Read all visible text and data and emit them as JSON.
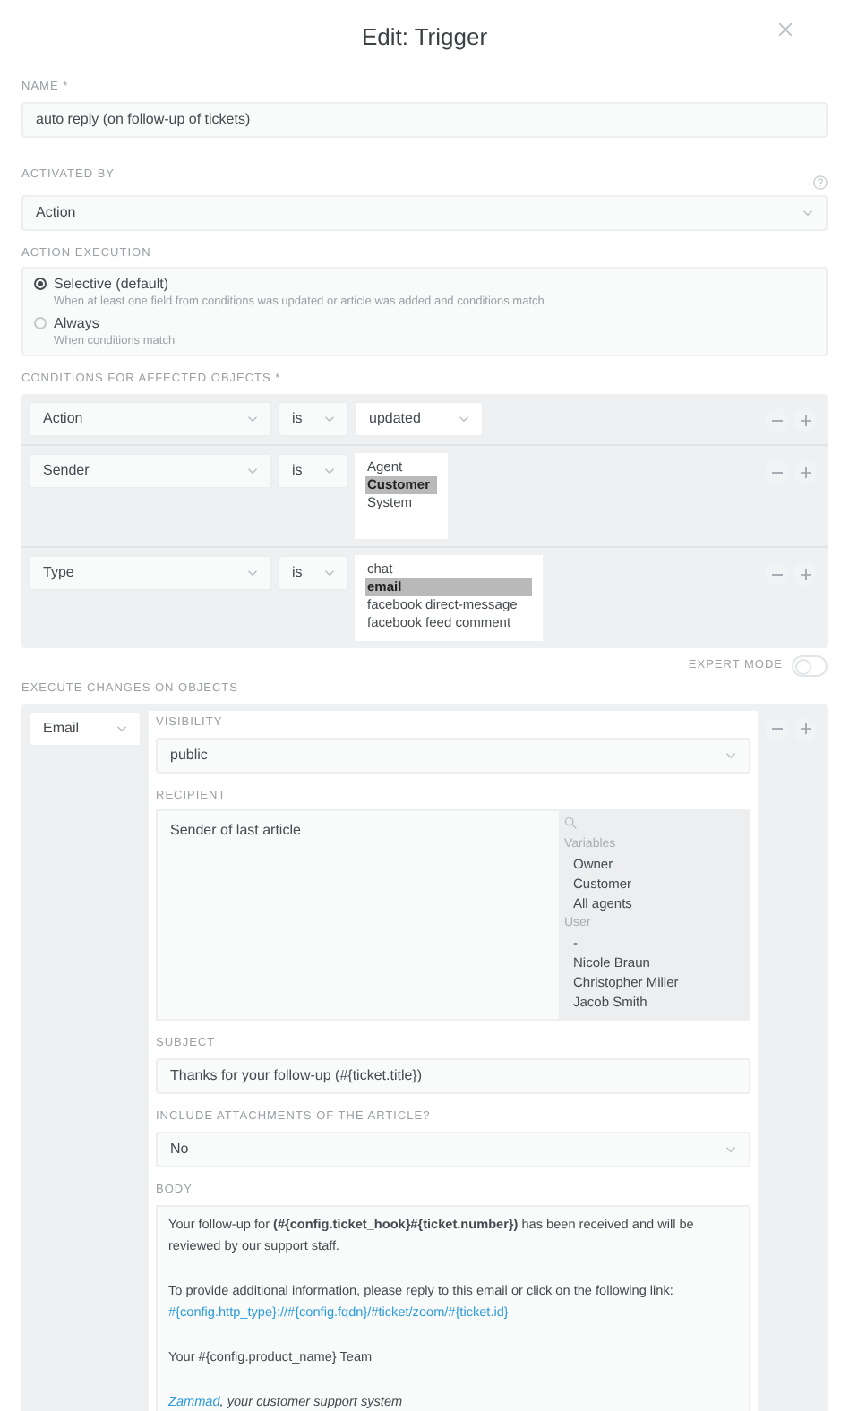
{
  "dialog": {
    "title": "Edit: Trigger"
  },
  "name": {
    "label": "NAME *",
    "value": "auto reply (on follow-up of tickets)"
  },
  "activated_by": {
    "label": "ACTIVATED BY",
    "value": "Action"
  },
  "action_execution": {
    "label": "ACTION EXECUTION",
    "options": [
      {
        "label": "Selective (default)",
        "description": "When at least one field from conditions was updated or article was added and conditions match",
        "selected": true
      },
      {
        "label": "Always",
        "description": "When conditions match",
        "selected": false
      }
    ]
  },
  "conditions": {
    "label": "CONDITIONS FOR AFFECTED OBJECTS *",
    "rows": [
      {
        "kind": "select",
        "attribute": "Action",
        "operator": "is",
        "value": "updated"
      },
      {
        "kind": "list",
        "attribute": "Sender",
        "operator": "is",
        "options": [
          {
            "label": "Agent",
            "selected": false
          },
          {
            "label": "Customer",
            "selected": true
          },
          {
            "label": "System",
            "selected": false
          }
        ]
      },
      {
        "kind": "list",
        "attribute": "Type",
        "operator": "is",
        "options": [
          {
            "label": "chat",
            "selected": false
          },
          {
            "label": "email",
            "selected": true
          },
          {
            "label": "facebook direct-message",
            "selected": false
          },
          {
            "label": "facebook feed comment",
            "selected": false
          }
        ]
      }
    ]
  },
  "expert_mode": {
    "label": "EXPERT MODE",
    "on": false
  },
  "execute": {
    "label": "EXECUTE CHANGES ON OBJECTS",
    "action": "Email",
    "visibility": {
      "label": "VISIBILITY",
      "value": "public"
    },
    "recipient": {
      "label": "RECIPIENT",
      "value": "Sender of last article",
      "groups": [
        {
          "label": "Variables",
          "items": [
            "Owner",
            "Customer",
            "All agents"
          ]
        },
        {
          "label": "User",
          "items": [
            "-",
            "Nicole Braun",
            "Christopher Miller",
            "Jacob Smith"
          ]
        }
      ]
    },
    "subject": {
      "label": "SUBJECT",
      "value": "Thanks for your follow-up (#{ticket.title})"
    },
    "attachments": {
      "label": "INCLUDE ATTACHMENTS OF THE ARTICLE?",
      "value": "No"
    },
    "body": {
      "label": "BODY",
      "paragraphs": [
        {
          "kind": "text",
          "text": "Your follow-up for **(#{config.ticket_hook}#{ticket.number})** has been received and will be reviewed by our support staff."
        },
        {
          "kind": "text_link",
          "text": "To provide additional information, please reply to this email or click on the following link:",
          "link": "#{config.http_type}://#{config.fqdn}/#ticket/zoom/#{ticket.id}"
        },
        {
          "kind": "text",
          "text": "Your #{config.product_name} Team"
        },
        {
          "kind": "signature",
          "link": "Zammad",
          "text": ", your customer support system"
        }
      ]
    }
  }
}
